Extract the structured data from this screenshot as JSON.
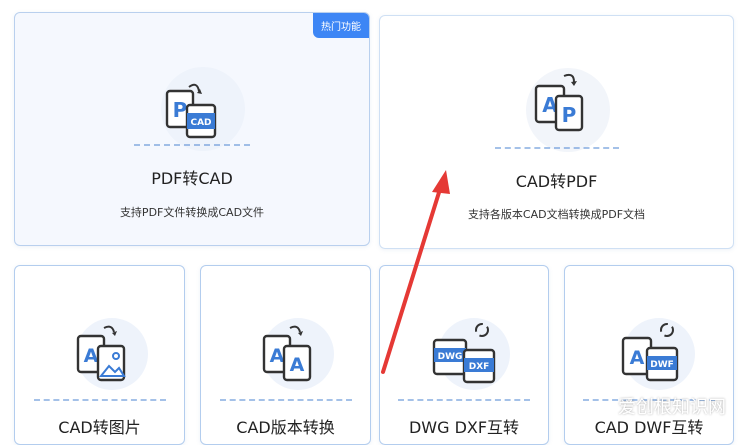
{
  "cards": {
    "pdf_to_cad": {
      "title": "PDF转CAD",
      "desc": "支持PDF文件转换成CAD文件",
      "badge": "热门功能",
      "icon": "pdf-to-cad-icon"
    },
    "cad_to_pdf": {
      "title": "CAD转PDF",
      "desc": "支持各版本CAD文档转换成PDF文档",
      "icon": "cad-to-pdf-icon"
    },
    "cad_to_image": {
      "title": "CAD转图片",
      "icon": "cad-to-image-icon"
    },
    "cad_version": {
      "title": "CAD版本转换",
      "icon": "cad-version-icon"
    },
    "dwg_dxf": {
      "title": "DWG DXF互转",
      "icon": "dwg-dxf-icon"
    },
    "cad_dwf": {
      "title": "CAD DWF互转",
      "icon": "cad-dwf-icon"
    }
  },
  "icon_letters": {
    "pdf_to_cad": [
      "P",
      "CAD"
    ],
    "cad_to_pdf": [
      "A",
      "P"
    ],
    "cad_to_image": [
      "A"
    ],
    "cad_version": [
      "A",
      "A"
    ],
    "dwg_dxf": [
      "DWG",
      "DXF"
    ],
    "cad_dwf": [
      "A",
      "DWF"
    ]
  },
  "watermark": "爱创根知识网",
  "colors": {
    "accent": "#3d86f5",
    "icon_blue": "#3a7bd5",
    "arrow_red": "#e53935",
    "card_border": "#cfe0f4"
  }
}
